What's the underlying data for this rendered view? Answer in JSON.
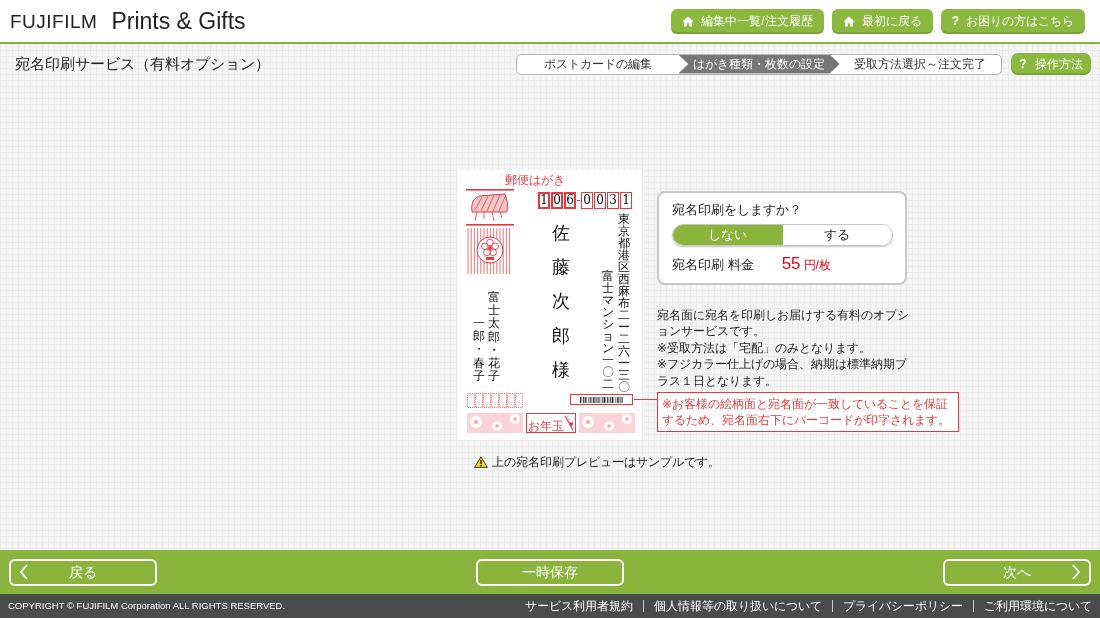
{
  "header": {
    "logo": {
      "brand": "FUJIFILM",
      "product": "Prints & Gifts"
    },
    "buttons": [
      {
        "kind": "home",
        "label": "編集中一覧/注文履歴"
      },
      {
        "kind": "home",
        "label": "最初に戻る"
      },
      {
        "kind": "help",
        "symbol": "?",
        "label": "お困りの方はこちら"
      }
    ]
  },
  "page_title": "宛名印刷サービス（有料オプション）",
  "steps": [
    {
      "label": "ポストカードの編集",
      "selected": false
    },
    {
      "label": "はがき種類・枚数の設定",
      "selected": true
    },
    {
      "label": "受取方法選択～注文完了",
      "selected": false
    }
  ],
  "help_button": {
    "symbol": "?",
    "label": "操作方法"
  },
  "postcard": {
    "heading": "郵便はがき",
    "postal_code": [
      "1",
      "0",
      "6",
      "0",
      "0",
      "3",
      "1"
    ],
    "recipient_address": [
      "富士マンション一〇二",
      "東京都港区西麻布二ー二六ー三〇"
    ],
    "recipient_name": "佐藤次郎様",
    "sender_names": [
      "一郎・春子",
      "富士太郎・花子"
    ],
    "lottery_label": "お年玉"
  },
  "option_panel": {
    "question": "宛名印刷をしますか？",
    "choices": [
      {
        "label": "しない",
        "selected": true
      },
      {
        "label": "する",
        "selected": false
      }
    ],
    "price_label": "宛名印刷 料金",
    "price": "55",
    "price_unit": "円/枚"
  },
  "description": [
    "宛名面に宛名を印刷しお届けする有料のオプションサービスです。",
    "※受取方法は「宅配」のみとなります。",
    "※フジカラー仕上げの場合、納期は標準納期プラス１日となります。"
  ],
  "barcode_note": "※お客様の絵柄面と宛名面が一致していることを保証するため、宛名面右下にバーコードが印字されます。",
  "sample_notice": "上の宛名印刷プレビューはサンプルです。",
  "nav_buttons": [
    {
      "kind": "back",
      "label": "戻る"
    },
    {
      "kind": "save",
      "label": "一時保存"
    },
    {
      "kind": "next",
      "label": "次へ"
    }
  ],
  "footer": {
    "copyright": "COPYRIGHT © FUJIFILM Corporation ALL RIGHTS RESERVED.",
    "links": [
      "サービス利用者規約",
      "個人情報等の取り扱いについて",
      "プライバシーポリシー",
      "ご利用環境について"
    ]
  }
}
